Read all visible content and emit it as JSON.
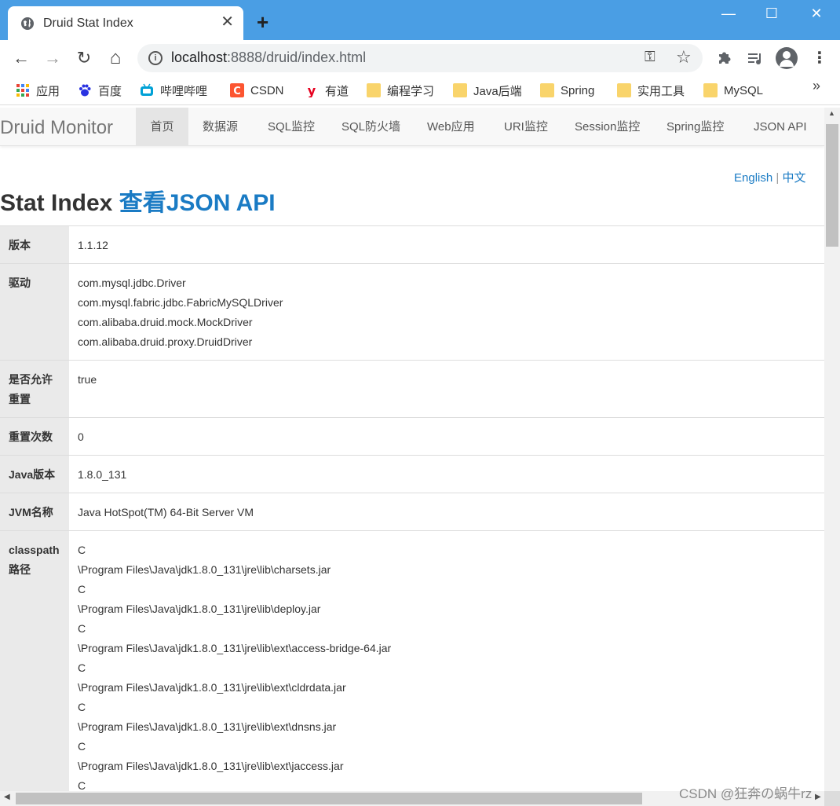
{
  "browser": {
    "tab_title": "Druid Stat Index",
    "tab_close": "✕",
    "new_tab": "+",
    "window_controls": {
      "minimize": "—",
      "maximize": "☐",
      "close": "✕"
    },
    "nav": {
      "back": "←",
      "forward": "→",
      "reload": "↻",
      "home": "⌂"
    },
    "url_host": "localhost",
    "url_path": ":8888/druid/index.html",
    "bookmarks": [
      {
        "label": "应用",
        "icon": "apps-grid-icon"
      },
      {
        "label": "百度",
        "icon": "baidu-paw-icon"
      },
      {
        "label": "哔哩哔哩",
        "icon": "bilibili-tv-icon"
      },
      {
        "label": "CSDN",
        "icon": "csdn-icon"
      },
      {
        "label": "有道",
        "icon": "youdao-icon"
      },
      {
        "label": "编程学习",
        "icon": "folder-icon"
      },
      {
        "label": "Java后端",
        "icon": "folder-icon"
      },
      {
        "label": "Spring",
        "icon": "folder-icon"
      },
      {
        "label": "实用工具",
        "icon": "folder-icon"
      },
      {
        "label": "MySQL",
        "icon": "folder-icon"
      }
    ],
    "bookmarks_more": "»"
  },
  "page": {
    "brand": "Druid Monitor",
    "nav": [
      "首页",
      "数据源",
      "SQL监控",
      "SQL防火墙",
      "Web应用",
      "URI监控",
      "Session监控",
      "Spring监控",
      "JSON API"
    ],
    "lang": {
      "english": "English",
      "sep": " | ",
      "chinese": "中文"
    },
    "heading": "Stat Index ",
    "heading_link": "查看JSON API",
    "rows": [
      {
        "key": "版本",
        "values": [
          "1.1.12"
        ]
      },
      {
        "key": "驱动",
        "values": [
          "com.mysql.jdbc.Driver",
          "com.mysql.fabric.jdbc.FabricMySQLDriver",
          "com.alibaba.druid.mock.MockDriver",
          "com.alibaba.druid.proxy.DruidDriver"
        ]
      },
      {
        "key": "是否允许重置",
        "values": [
          "true"
        ]
      },
      {
        "key": "重置次数",
        "values": [
          "0"
        ]
      },
      {
        "key": "Java版本",
        "values": [
          "1.8.0_131"
        ]
      },
      {
        "key": "JVM名称",
        "values": [
          "Java HotSpot(TM) 64-Bit Server VM"
        ]
      },
      {
        "key": "classpath路径",
        "values": [
          "C",
          "\\Program Files\\Java\\jdk1.8.0_131\\jre\\lib\\charsets.jar",
          "C",
          "\\Program Files\\Java\\jdk1.8.0_131\\jre\\lib\\deploy.jar",
          "C",
          "\\Program Files\\Java\\jdk1.8.0_131\\jre\\lib\\ext\\access-bridge-64.jar",
          "C",
          "\\Program Files\\Java\\jdk1.8.0_131\\jre\\lib\\ext\\cldrdata.jar",
          "C",
          "\\Program Files\\Java\\jdk1.8.0_131\\jre\\lib\\ext\\dnsns.jar",
          "C",
          "\\Program Files\\Java\\jdk1.8.0_131\\jre\\lib\\ext\\jaccess.jar",
          "C"
        ]
      }
    ]
  },
  "watermark": "CSDN @狂奔の蜗牛rz",
  "colors": {
    "titlebar": "#4a9ee4",
    "link": "#1a7bc4",
    "key_cell_bg": "#eaeaea",
    "navbar_bg": "#f8f8f8"
  }
}
